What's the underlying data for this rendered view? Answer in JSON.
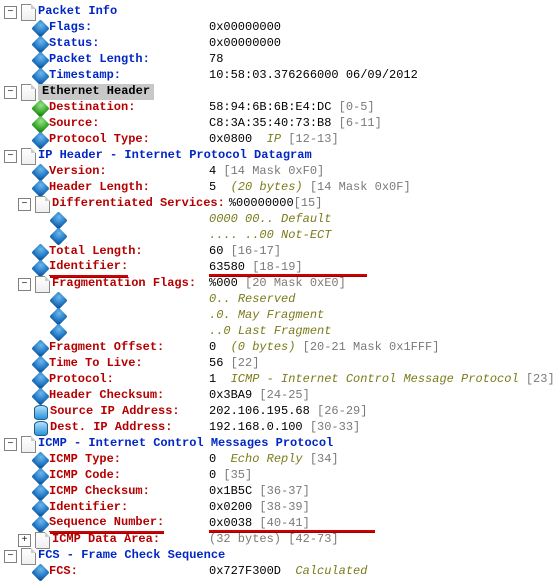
{
  "packet_info": {
    "title": "Packet Info",
    "flags": {
      "label": "Flags:",
      "value": "0x00000000"
    },
    "status": {
      "label": "Status:",
      "value": "0x00000000"
    },
    "length": {
      "label": "Packet Length:",
      "value": "78"
    },
    "timestamp": {
      "label": "Timestamp:",
      "value": "10:58:03.376266000 06/09/2012"
    }
  },
  "ethernet": {
    "title": "Ethernet Header",
    "destination": {
      "label": "Destination:",
      "value": "58:94:6B:6B:E4:DC",
      "note": "[0-5]"
    },
    "source": {
      "label": "Source:",
      "value": "C8:3A:35:40:73:B8",
      "note": "[6-11]"
    },
    "proto": {
      "label": "Protocol Type:",
      "value": "0x0800",
      "italic": "IP",
      "note": "[12-13]"
    }
  },
  "ip": {
    "title": "IP Header - Internet Protocol Datagram",
    "version": {
      "label": "Version:",
      "value": "4",
      "note": "[14 Mask 0xF0]"
    },
    "hlen": {
      "label": "Header Length:",
      "value": "5",
      "italic": "(20 bytes)",
      "note": "[14 Mask 0x0F]"
    },
    "diffserv": {
      "label": "Differentiated Services:",
      "value": "%00000000",
      "note": "[15]"
    },
    "diff1": {
      "bits": "0000 00..",
      "desc": "Default"
    },
    "diff2": {
      "bits": ".... ..00",
      "desc": "Not-ECT"
    },
    "totlen": {
      "label": "Total Length:",
      "value": "60",
      "note": "[16-17]"
    },
    "ident": {
      "label": "Identifier:",
      "value": "63580",
      "note": "[18-19]"
    },
    "frag": {
      "label": "Fragmentation Flags:",
      "value": "%000",
      "note": "[20 Mask 0xE0]"
    },
    "frag1": {
      "bits": "0..",
      "desc": "Reserved"
    },
    "frag2": {
      "bits": ".0.",
      "desc": "May Fragment"
    },
    "frag3": {
      "bits": "..0",
      "desc": "Last Fragment"
    },
    "fragoff": {
      "label": "Fragment Offset:",
      "value": "0",
      "italic": "(0 bytes)",
      "note": "[20-21 Mask 0x1FFF]"
    },
    "ttl": {
      "label": "Time To Live:",
      "value": "56",
      "note": "[22]"
    },
    "protocol": {
      "label": "Protocol:",
      "value": "1",
      "italic": "ICMP - Internet Control Message Protocol",
      "note": "[23]"
    },
    "hchksum": {
      "label": "Header Checksum:",
      "value": "0x3BA9",
      "note": "[24-25]"
    },
    "src": {
      "label": "Source IP Address:",
      "value": "202.106.195.68",
      "note": "[26-29]"
    },
    "dst": {
      "label": "Dest. IP Address:",
      "value": "192.168.0.100",
      "note": "[30-33]"
    }
  },
  "icmp": {
    "title": "ICMP - Internet Control Messages Protocol",
    "type": {
      "label": "ICMP Type:",
      "value": "0",
      "italic": "Echo Reply",
      "note": "[34]"
    },
    "code": {
      "label": "ICMP Code:",
      "value": "0",
      "note": "[35]"
    },
    "chk": {
      "label": "ICMP Checksum:",
      "value": "0x1B5C",
      "note": "[36-37]"
    },
    "ident": {
      "label": "Identifier:",
      "value": "0x0200",
      "note": "[38-39]"
    },
    "seq": {
      "label": "Sequence Number:",
      "value": "0x0038",
      "note": "[40-41]"
    },
    "data": {
      "label": "ICMP Data Area:",
      "value": "(32 bytes)",
      "note": "[42-73]"
    }
  },
  "fcs": {
    "title": "FCS - Frame Check Sequence",
    "fcs": {
      "label": "FCS:",
      "value": "0x727F300D",
      "italic": "Calculated"
    }
  }
}
